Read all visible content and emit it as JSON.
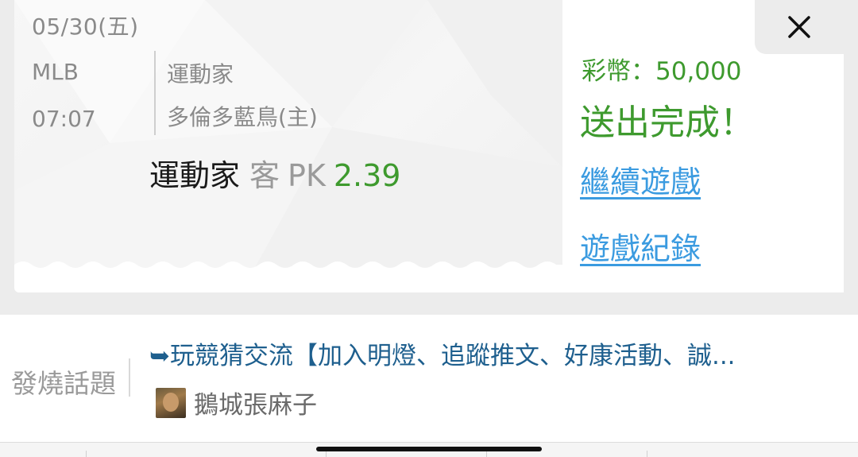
{
  "ticket": {
    "date": "05/30(五)",
    "league": "MLB",
    "time": "07:07",
    "team_away": "運動家",
    "team_home": "多倫多藍鳥(主)",
    "bet_team": "運動家",
    "bet_side": "客",
    "bet_type": "PK",
    "bet_odds": "2.39"
  },
  "result_panel": {
    "coins_label": "彩幣：50,000",
    "sent_message": "送出完成！",
    "continue_link": "繼續遊戲",
    "record_link": "遊戲紀錄",
    "close_icon": "close-icon"
  },
  "hot_topic": {
    "label": "發燒話題",
    "topic_text": "➥玩競猜交流【加入明燈、追蹤推文、好康活動、誠...",
    "author": "鵝城張麻子",
    "avatar_icon": "user-avatar"
  },
  "colors": {
    "accent_green": "#3e9a2e",
    "link_blue": "#3b9be0",
    "topic_blue": "#1e5f8e"
  }
}
